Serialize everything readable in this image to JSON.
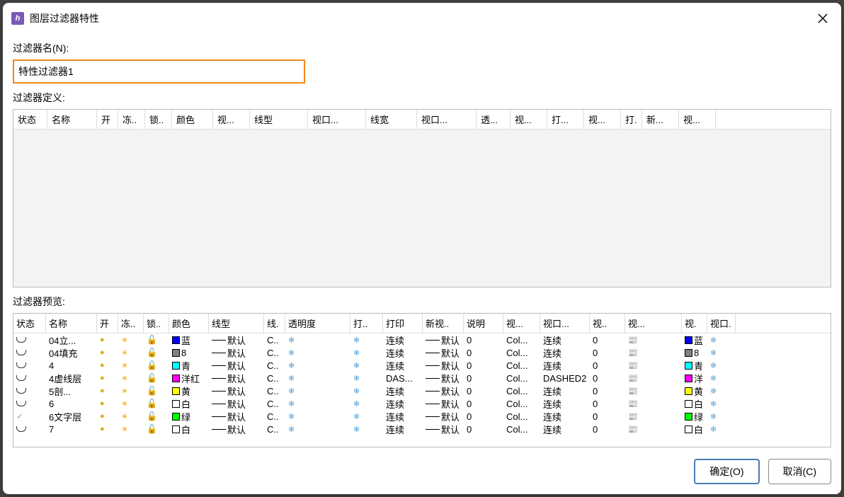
{
  "title": "图层过滤器特性",
  "labels": {
    "filterName": "过滤器名(N):",
    "filterDef": "过滤器定义:",
    "filterPreview": "过滤器预览:"
  },
  "filterNameValue": "特性过滤器1",
  "defHeaders": [
    "状态",
    "名称",
    "开",
    "冻..",
    "锁..",
    "颜色",
    "视...",
    "线型",
    "视口...",
    "线宽",
    "视口...",
    "透...",
    "视...",
    "打...",
    "视...",
    "打.",
    "新...",
    "视..."
  ],
  "defWidths": [
    48,
    70,
    30,
    38,
    38,
    58,
    52,
    82,
    82,
    72,
    84,
    48,
    52,
    52,
    52,
    30,
    52,
    52
  ],
  "previewHeaders": [
    "状态",
    "名称",
    "开",
    "冻..",
    "锁..",
    "颜色",
    "线型",
    "线.",
    "透明度",
    "打..",
    "打印",
    "新视..",
    "说明",
    "视...",
    "视口...",
    "视..",
    "视...",
    "视.",
    "视口."
  ],
  "previewWidths": [
    46,
    72,
    30,
    36,
    36,
    56,
    78,
    30,
    92,
    46,
    56,
    58,
    56,
    52,
    70,
    50,
    80,
    36,
    40
  ],
  "rows": [
    {
      "status": "shape",
      "name": "04立...",
      "colorSwatch": "#0000ff",
      "colorName": "蓝",
      "linetype": "默认",
      "lineC": "C..",
      "print": "连续",
      "printLine": "默认",
      "trans": "0",
      "vp1": "Col...",
      "vp2": "连续",
      "vp3": "0",
      "sw2": "#0000ff",
      "cn2": "蓝"
    },
    {
      "status": "shape",
      "name": "04填充",
      "colorSwatch": "#808080",
      "colorName": "8",
      "linetype": "默认",
      "lineC": "C..",
      "print": "连续",
      "printLine": "默认",
      "trans": "0",
      "vp1": "Col...",
      "vp2": "连续",
      "vp3": "0",
      "sw2": "#808080",
      "cn2": "8"
    },
    {
      "status": "shape",
      "name": "4",
      "colorSwatch": "#00ffff",
      "colorName": "青",
      "linetype": "默认",
      "lineC": "C..",
      "print": "连续",
      "printLine": "默认",
      "trans": "0",
      "vp1": "Col...",
      "vp2": "连续",
      "vp3": "0",
      "sw2": "#00ffff",
      "cn2": "青"
    },
    {
      "status": "shape",
      "name": "4虚线层",
      "colorSwatch": "#ff00ff",
      "colorName": "洋红",
      "linetype": "默认",
      "lineC": "C..",
      "print": "DAS...",
      "printLine": "默认",
      "trans": "0",
      "vp1": "Col...",
      "vp2": "DASHED2",
      "vp3": "0",
      "sw2": "#ff00ff",
      "cn2": "洋"
    },
    {
      "status": "shape",
      "name": "5剖...",
      "colorSwatch": "#ffff00",
      "colorName": "黄",
      "linetype": "默认",
      "lineC": "C..",
      "print": "连续",
      "printLine": "默认",
      "trans": "0",
      "vp1": "Col...",
      "vp2": "连续",
      "vp3": "0",
      "sw2": "#ffff00",
      "cn2": "黄"
    },
    {
      "status": "shape",
      "name": "6",
      "colorSwatch": "#ffffff",
      "colorName": "白",
      "linetype": "默认",
      "lineC": "C..",
      "print": "连续",
      "printLine": "默认",
      "trans": "0",
      "vp1": "Col...",
      "vp2": "连续",
      "vp3": "0",
      "sw2": "#ffffff",
      "cn2": "白"
    },
    {
      "status": "check",
      "name": "6文字层",
      "colorSwatch": "#00ff00",
      "colorName": "绿",
      "linetype": "默认",
      "lineC": "C..",
      "print": "连续",
      "printLine": "默认",
      "trans": "0",
      "vp1": "Col...",
      "vp2": "连续",
      "vp3": "0",
      "sw2": "#00ff00",
      "cn2": "绿"
    },
    {
      "status": "shape",
      "name": "7",
      "colorSwatch": "#ffffff",
      "colorName": "白",
      "linetype": "默认",
      "lineC": "C..",
      "print": "连续",
      "printLine": "默认",
      "trans": "0",
      "vp1": "Col...",
      "vp2": "连续",
      "vp3": "0",
      "sw2": "#ffffff",
      "cn2": "白"
    }
  ],
  "buttons": {
    "ok": "确定(O)",
    "cancel": "取消(C)"
  }
}
